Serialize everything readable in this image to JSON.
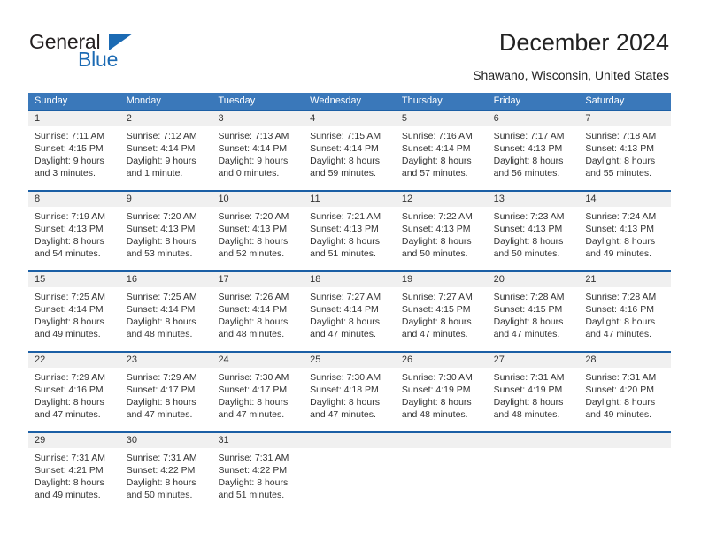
{
  "brand": {
    "name_top": "General",
    "name_bottom": "Blue",
    "triangle_icon": "triangle-icon",
    "color_dark": "#231f20",
    "color_blue": "#1b6ab3"
  },
  "header": {
    "title": "December 2024",
    "subtitle": "Shawano, Wisconsin, United States"
  },
  "theme": {
    "header_bg": "#3a78ba",
    "separator": "#1b5fa5",
    "daynum_bg": "#f0f0f0",
    "text": "#333333"
  },
  "weekdays": [
    "Sunday",
    "Monday",
    "Tuesday",
    "Wednesday",
    "Thursday",
    "Friday",
    "Saturday"
  ],
  "weeks": [
    {
      "days": [
        {
          "num": "1",
          "sunrise": "Sunrise: 7:11 AM",
          "sunset": "Sunset: 4:15 PM",
          "daylight1": "Daylight: 9 hours",
          "daylight2": "and 3 minutes."
        },
        {
          "num": "2",
          "sunrise": "Sunrise: 7:12 AM",
          "sunset": "Sunset: 4:14 PM",
          "daylight1": "Daylight: 9 hours",
          "daylight2": "and 1 minute."
        },
        {
          "num": "3",
          "sunrise": "Sunrise: 7:13 AM",
          "sunset": "Sunset: 4:14 PM",
          "daylight1": "Daylight: 9 hours",
          "daylight2": "and 0 minutes."
        },
        {
          "num": "4",
          "sunrise": "Sunrise: 7:15 AM",
          "sunset": "Sunset: 4:14 PM",
          "daylight1": "Daylight: 8 hours",
          "daylight2": "and 59 minutes."
        },
        {
          "num": "5",
          "sunrise": "Sunrise: 7:16 AM",
          "sunset": "Sunset: 4:14 PM",
          "daylight1": "Daylight: 8 hours",
          "daylight2": "and 57 minutes."
        },
        {
          "num": "6",
          "sunrise": "Sunrise: 7:17 AM",
          "sunset": "Sunset: 4:13 PM",
          "daylight1": "Daylight: 8 hours",
          "daylight2": "and 56 minutes."
        },
        {
          "num": "7",
          "sunrise": "Sunrise: 7:18 AM",
          "sunset": "Sunset: 4:13 PM",
          "daylight1": "Daylight: 8 hours",
          "daylight2": "and 55 minutes."
        }
      ]
    },
    {
      "days": [
        {
          "num": "8",
          "sunrise": "Sunrise: 7:19 AM",
          "sunset": "Sunset: 4:13 PM",
          "daylight1": "Daylight: 8 hours",
          "daylight2": "and 54 minutes."
        },
        {
          "num": "9",
          "sunrise": "Sunrise: 7:20 AM",
          "sunset": "Sunset: 4:13 PM",
          "daylight1": "Daylight: 8 hours",
          "daylight2": "and 53 minutes."
        },
        {
          "num": "10",
          "sunrise": "Sunrise: 7:20 AM",
          "sunset": "Sunset: 4:13 PM",
          "daylight1": "Daylight: 8 hours",
          "daylight2": "and 52 minutes."
        },
        {
          "num": "11",
          "sunrise": "Sunrise: 7:21 AM",
          "sunset": "Sunset: 4:13 PM",
          "daylight1": "Daylight: 8 hours",
          "daylight2": "and 51 minutes."
        },
        {
          "num": "12",
          "sunrise": "Sunrise: 7:22 AM",
          "sunset": "Sunset: 4:13 PM",
          "daylight1": "Daylight: 8 hours",
          "daylight2": "and 50 minutes."
        },
        {
          "num": "13",
          "sunrise": "Sunrise: 7:23 AM",
          "sunset": "Sunset: 4:13 PM",
          "daylight1": "Daylight: 8 hours",
          "daylight2": "and 50 minutes."
        },
        {
          "num": "14",
          "sunrise": "Sunrise: 7:24 AM",
          "sunset": "Sunset: 4:13 PM",
          "daylight1": "Daylight: 8 hours",
          "daylight2": "and 49 minutes."
        }
      ]
    },
    {
      "days": [
        {
          "num": "15",
          "sunrise": "Sunrise: 7:25 AM",
          "sunset": "Sunset: 4:14 PM",
          "daylight1": "Daylight: 8 hours",
          "daylight2": "and 49 minutes."
        },
        {
          "num": "16",
          "sunrise": "Sunrise: 7:25 AM",
          "sunset": "Sunset: 4:14 PM",
          "daylight1": "Daylight: 8 hours",
          "daylight2": "and 48 minutes."
        },
        {
          "num": "17",
          "sunrise": "Sunrise: 7:26 AM",
          "sunset": "Sunset: 4:14 PM",
          "daylight1": "Daylight: 8 hours",
          "daylight2": "and 48 minutes."
        },
        {
          "num": "18",
          "sunrise": "Sunrise: 7:27 AM",
          "sunset": "Sunset: 4:14 PM",
          "daylight1": "Daylight: 8 hours",
          "daylight2": "and 47 minutes."
        },
        {
          "num": "19",
          "sunrise": "Sunrise: 7:27 AM",
          "sunset": "Sunset: 4:15 PM",
          "daylight1": "Daylight: 8 hours",
          "daylight2": "and 47 minutes."
        },
        {
          "num": "20",
          "sunrise": "Sunrise: 7:28 AM",
          "sunset": "Sunset: 4:15 PM",
          "daylight1": "Daylight: 8 hours",
          "daylight2": "and 47 minutes."
        },
        {
          "num": "21",
          "sunrise": "Sunrise: 7:28 AM",
          "sunset": "Sunset: 4:16 PM",
          "daylight1": "Daylight: 8 hours",
          "daylight2": "and 47 minutes."
        }
      ]
    },
    {
      "days": [
        {
          "num": "22",
          "sunrise": "Sunrise: 7:29 AM",
          "sunset": "Sunset: 4:16 PM",
          "daylight1": "Daylight: 8 hours",
          "daylight2": "and 47 minutes."
        },
        {
          "num": "23",
          "sunrise": "Sunrise: 7:29 AM",
          "sunset": "Sunset: 4:17 PM",
          "daylight1": "Daylight: 8 hours",
          "daylight2": "and 47 minutes."
        },
        {
          "num": "24",
          "sunrise": "Sunrise: 7:30 AM",
          "sunset": "Sunset: 4:17 PM",
          "daylight1": "Daylight: 8 hours",
          "daylight2": "and 47 minutes."
        },
        {
          "num": "25",
          "sunrise": "Sunrise: 7:30 AM",
          "sunset": "Sunset: 4:18 PM",
          "daylight1": "Daylight: 8 hours",
          "daylight2": "and 47 minutes."
        },
        {
          "num": "26",
          "sunrise": "Sunrise: 7:30 AM",
          "sunset": "Sunset: 4:19 PM",
          "daylight1": "Daylight: 8 hours",
          "daylight2": "and 48 minutes."
        },
        {
          "num": "27",
          "sunrise": "Sunrise: 7:31 AM",
          "sunset": "Sunset: 4:19 PM",
          "daylight1": "Daylight: 8 hours",
          "daylight2": "and 48 minutes."
        },
        {
          "num": "28",
          "sunrise": "Sunrise: 7:31 AM",
          "sunset": "Sunset: 4:20 PM",
          "daylight1": "Daylight: 8 hours",
          "daylight2": "and 49 minutes."
        }
      ]
    },
    {
      "days": [
        {
          "num": "29",
          "sunrise": "Sunrise: 7:31 AM",
          "sunset": "Sunset: 4:21 PM",
          "daylight1": "Daylight: 8 hours",
          "daylight2": "and 49 minutes."
        },
        {
          "num": "30",
          "sunrise": "Sunrise: 7:31 AM",
          "sunset": "Sunset: 4:22 PM",
          "daylight1": "Daylight: 8 hours",
          "daylight2": "and 50 minutes."
        },
        {
          "num": "31",
          "sunrise": "Sunrise: 7:31 AM",
          "sunset": "Sunset: 4:22 PM",
          "daylight1": "Daylight: 8 hours",
          "daylight2": "and 51 minutes."
        },
        {
          "num": "",
          "sunrise": "",
          "sunset": "",
          "daylight1": "",
          "daylight2": ""
        },
        {
          "num": "",
          "sunrise": "",
          "sunset": "",
          "daylight1": "",
          "daylight2": ""
        },
        {
          "num": "",
          "sunrise": "",
          "sunset": "",
          "daylight1": "",
          "daylight2": ""
        },
        {
          "num": "",
          "sunrise": "",
          "sunset": "",
          "daylight1": "",
          "daylight2": ""
        }
      ]
    }
  ]
}
